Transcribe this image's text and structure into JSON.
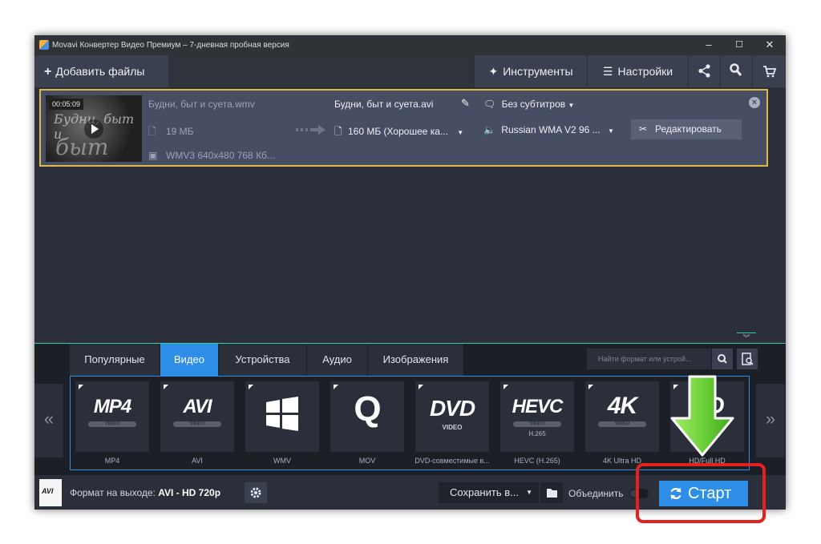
{
  "window": {
    "title": "Movavi Конвертер Видео Премиум – 7-дневная пробная версия",
    "controls": {
      "minimize": "–",
      "maximize": "☐",
      "close": "✕"
    }
  },
  "toolbar": {
    "add_files": "Добавить файлы",
    "tools": "Инструменты",
    "settings": "Настройки",
    "icons": [
      "share-icon",
      "wrench-icon",
      "cart-icon"
    ]
  },
  "file": {
    "duration": "00:05:09",
    "source_name": "Будни, быт и суета.wmv",
    "source_size": "19 МБ",
    "source_info": "WMV3 640x480 768 Кб...",
    "output_name": "Будни, быт и суета.avi",
    "output_size": "160 МБ (Хорошее ка...",
    "subtitles": "Без субтитров",
    "audio": "Russian WMA V2 96 ...",
    "edit_label": "Редактировать",
    "thumb_text_1": "Будни, быт и",
    "thumb_text_2": "быт"
  },
  "format_tabs": {
    "tabs": [
      "Популярные",
      "Видео",
      "Устройства",
      "Аудио",
      "Изображения"
    ],
    "active": "Видео",
    "search_placeholder": "Найти формат или устрой..."
  },
  "formats": [
    {
      "logo": "MP4",
      "badge": "VIDEO",
      "label": "MP4"
    },
    {
      "logo": "AVI",
      "badge": "VIDEO",
      "label": "AVI"
    },
    {
      "logo": "",
      "badge": "",
      "label": "WMV"
    },
    {
      "logo": "Q",
      "badge": "",
      "label": "MOV"
    },
    {
      "logo": "DVD",
      "badge": "VIDEO",
      "label": "DVD-совместимые в..."
    },
    {
      "logo": "HEVC",
      "badge": "VIDEO",
      "label": "HEVC (H.265)",
      "extra": "H.265"
    },
    {
      "logo": "4K",
      "badge": "VIDEO",
      "label": "4K Ultra HD"
    },
    {
      "logo": "HD",
      "badge": "",
      "label": "HD/Full HD"
    }
  ],
  "bottom": {
    "output_format_label": "Формат на выходе:",
    "output_format_value": "AVI - HD 720p",
    "save_to": "Сохранить в...",
    "merge": "Объединить",
    "start": "Старт"
  },
  "colors": {
    "accent_blue": "#2f8fe8",
    "highlight_red": "#e32121",
    "selection_gold": "#e0b84a",
    "arrow_green": "#6ed23a"
  }
}
